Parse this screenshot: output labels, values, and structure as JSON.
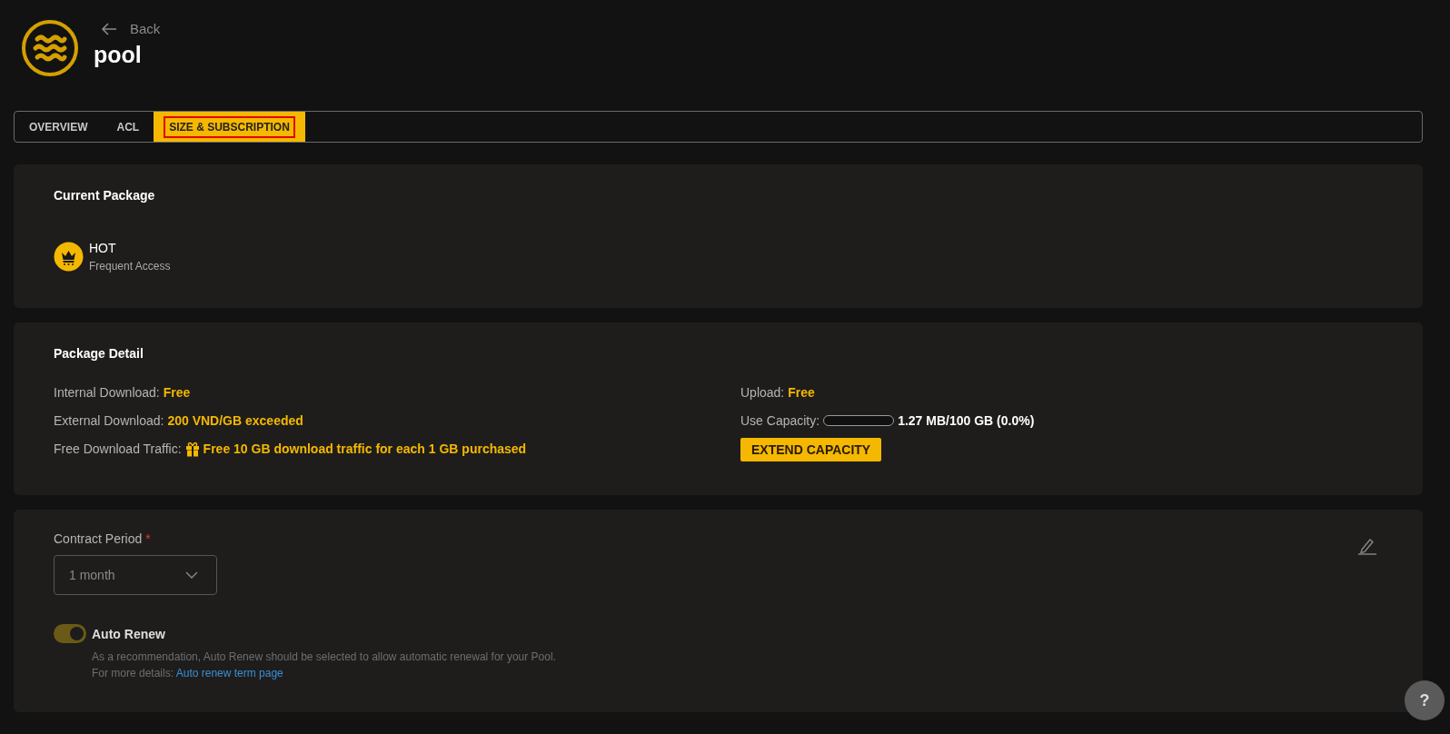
{
  "header": {
    "back_label": "Back",
    "title": "pool"
  },
  "tabs": [
    {
      "label": "OVERVIEW",
      "selected": false
    },
    {
      "label": "ACL",
      "selected": false
    },
    {
      "label": "SIZE & SUBSCRIPTION",
      "selected": true
    }
  ],
  "current_package": {
    "title": "Current Package",
    "name": "HOT",
    "description": "Frequent Access"
  },
  "package_detail": {
    "title": "Package Detail",
    "left": [
      {
        "kind": "text",
        "label": "Internal Download:",
        "value": "Free"
      },
      {
        "kind": "text",
        "label": "External Download:",
        "value": "200 VND/GB exceeded"
      },
      {
        "kind": "gift",
        "label": "Free Download Traffic:",
        "value": "Free 10 GB download traffic for each 1 GB purchased"
      }
    ],
    "upload": {
      "label": "Upload:",
      "value": "Free"
    },
    "capacity": {
      "label": "Use Capacity:",
      "level": 0,
      "reading": "1.27 MB/100 GB (0.0%)"
    },
    "extend_button": "EXTEND CAPACITY"
  },
  "contract": {
    "label": "Contract Period",
    "required_mark": "*",
    "period": "1 month",
    "auto_renew": {
      "label": "Auto Renew",
      "on": true,
      "description": "As a recommendation, Auto Renew should be selected to allow automatic renewal for your Pool.",
      "details_label": "For more details:",
      "details_link": "Auto renew term page"
    }
  },
  "help_button": "?"
}
